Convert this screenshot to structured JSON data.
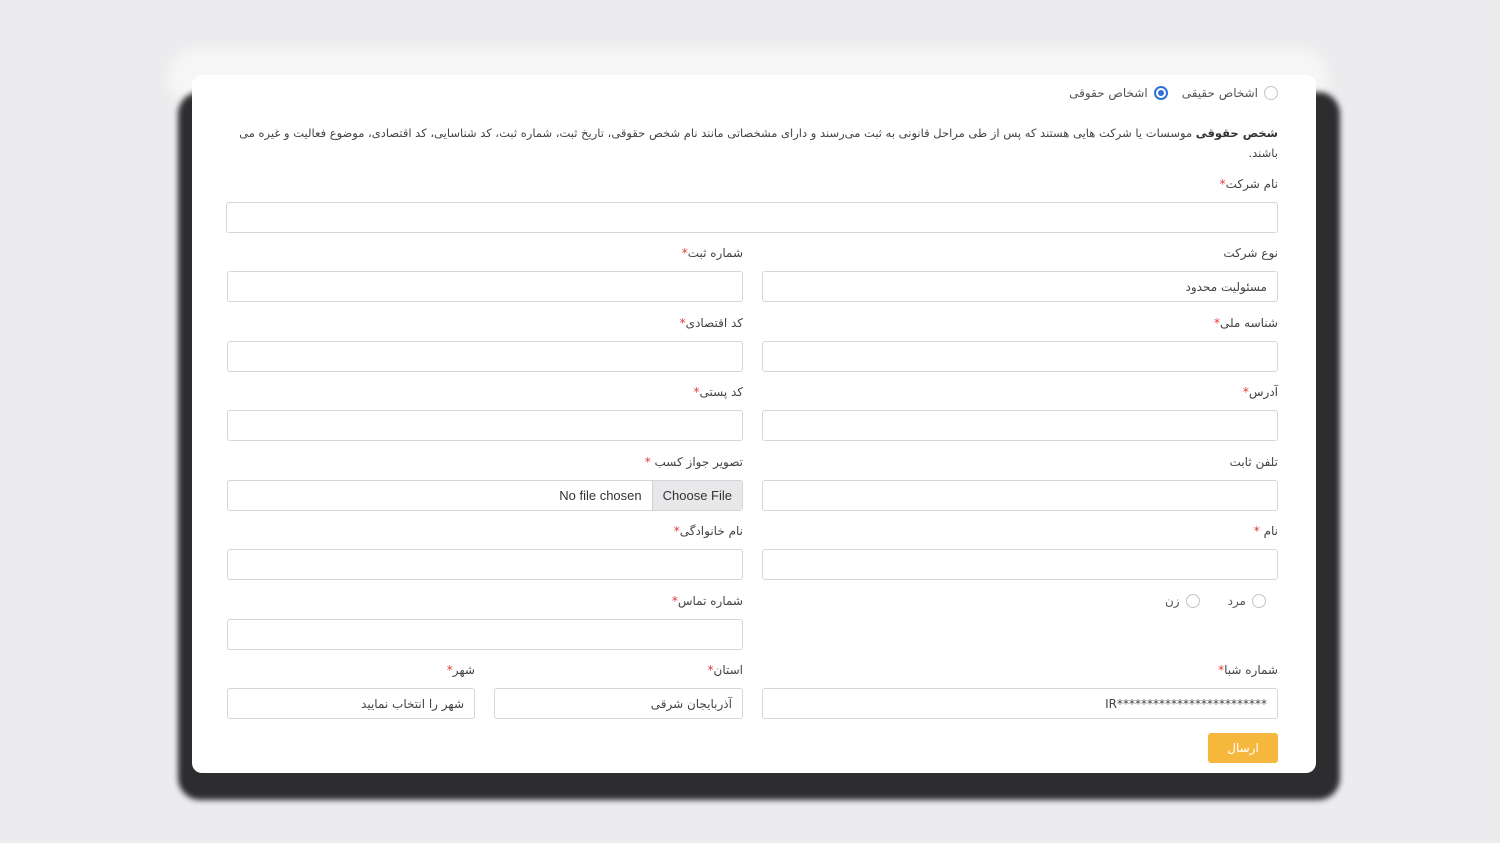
{
  "person_type": {
    "real_label": "اشخاص حقیقی",
    "legal_label": "اشخاص حقوقی"
  },
  "description": {
    "bold": "شخص حقوقی",
    "text": " موسسات یا شرکت هایی هستند که پس از طی مراحل قانونی به ثبت می‌رسند و دارای مشخصاتی مانند نام شخص حقوقی، تاریخ ثبت، شماره ثبت، کد شناسایی، کد اقتصادی، موضوع فعالیت و غیره می باشند."
  },
  "fields": {
    "company_name": {
      "label": "نام شرکت",
      "value": ""
    },
    "company_type": {
      "label": "نوع شرکت",
      "value": "مسئولیت محدود"
    },
    "registration_number": {
      "label": "شماره ثبت",
      "value": ""
    },
    "national_id": {
      "label": "شناسه ملی",
      "value": ""
    },
    "economic_code": {
      "label": "کد اقتصادی",
      "value": ""
    },
    "address": {
      "label": "آدرس",
      "value": ""
    },
    "postal_code": {
      "label": "کد پستی",
      "value": ""
    },
    "landline": {
      "label": "تلفن ثابت",
      "value": ""
    },
    "license_image": {
      "label": "تصویر جواز کسب",
      "button": "Choose File",
      "status": "No file chosen"
    },
    "first_name": {
      "label": "نام",
      "value": ""
    },
    "last_name": {
      "label": "نام خانوادگی",
      "value": ""
    },
    "contact_number": {
      "label": "شماره تماس",
      "value": ""
    },
    "sheba": {
      "label": "شماره شبا",
      "value": "IR*************************"
    },
    "province": {
      "label": "استان",
      "value": "آذربایجان شرقی"
    },
    "city": {
      "label": "شهر",
      "value": "شهر را انتخاب نمایید"
    }
  },
  "gender": {
    "male_label": "مرد",
    "female_label": "زن"
  },
  "required_mark": "*",
  "submit_label": "ارسال",
  "colors": {
    "accent": "#f5b83d",
    "radio_selected": "#2f6fd8",
    "required": "#e53935"
  }
}
